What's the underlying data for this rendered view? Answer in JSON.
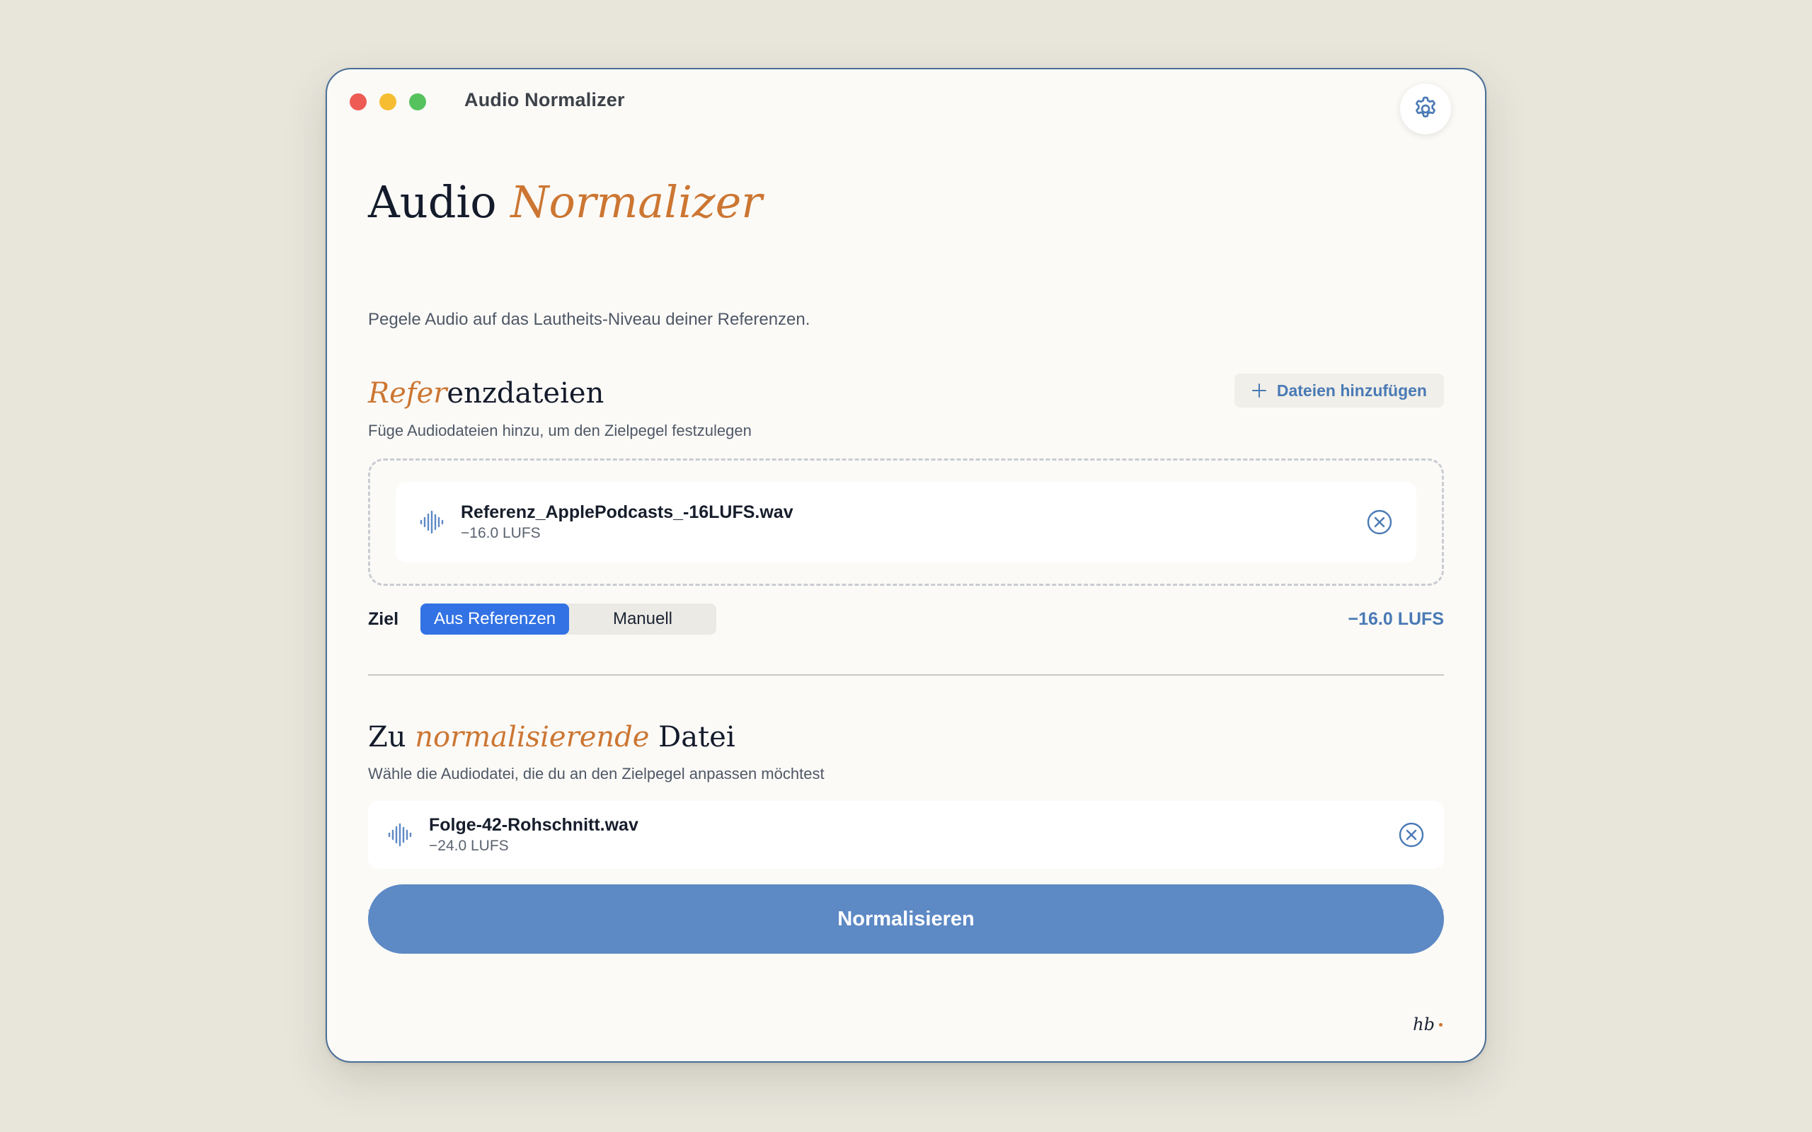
{
  "window": {
    "title": "Audio Normalizer"
  },
  "header": {
    "title_plain": "Audio",
    "title_accent": "Normalizer",
    "subtitle": "Pegele Audio auf das Lautheits-Niveau deiner Referenzen."
  },
  "references": {
    "title_accent": "Refer",
    "title_rest": "enzdateien",
    "description": "Füge Audiodateien hinzu, um den Zielpegel festzulegen",
    "add_button_label": "Dateien hinzufügen",
    "files": [
      {
        "name": "Referenz_ApplePodcasts_-16LUFS.wav",
        "lufs": "−16.0 LUFS"
      }
    ]
  },
  "target": {
    "label": "Ziel",
    "options": [
      "Aus Referenzen",
      "Manuell"
    ],
    "selected": "Aus Referenzen",
    "value": "−16.0 LUFS"
  },
  "input": {
    "title_start": "Zu ",
    "title_accent": "normalisierende",
    "title_end": " Datei",
    "description": "Wähle die Audiodatei, die du an den Zielpegel anpassen möchtest",
    "file": {
      "name": "Folge-42-Rohschnitt.wav",
      "lufs": "−24.0 LUFS"
    }
  },
  "actions": {
    "normalize_label": "Normalisieren"
  },
  "footer": {
    "logo_text": "hb"
  },
  "icons": {
    "settings": "gear-icon",
    "add": "plus-icon",
    "file": "waveform-icon",
    "remove": "close-circle-icon"
  },
  "colors": {
    "accent": "#cc7632",
    "primary": "#3272e4",
    "button": "#5d89c5",
    "link": "#4a7ab5",
    "background": "#e8e6db"
  }
}
